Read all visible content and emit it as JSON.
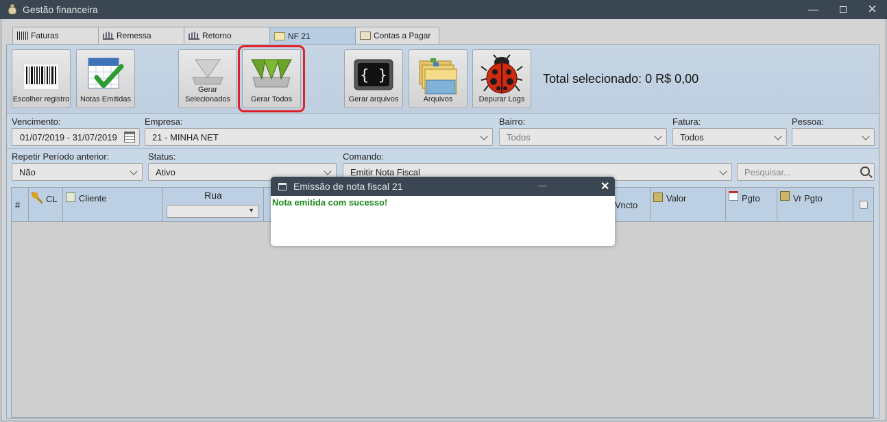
{
  "window": {
    "title": "Gestão financeira",
    "minimize_icon": "minimize-icon",
    "maximize_icon": "maximize-icon",
    "close_icon": "close-icon"
  },
  "tabs": [
    {
      "label": "Faturas",
      "icon": "barcode-icon",
      "active": false
    },
    {
      "label": "Remessa",
      "icon": "bank-icon",
      "active": false
    },
    {
      "label": "Retorno",
      "icon": "bank-icon",
      "active": false
    },
    {
      "label": "NF 21",
      "icon": "certificate-icon",
      "active": true
    },
    {
      "label": "Contas a Pagar",
      "icon": "bill-icon",
      "active": false
    }
  ],
  "toolbar": {
    "buttons": [
      {
        "label": "Escolher registro",
        "icon": "barcode-icon"
      },
      {
        "label": "Notas Emitidas",
        "icon": "calendar-check-icon"
      },
      {
        "label": "Gerar Selecionados",
        "icon": "generate-selected-icon"
      },
      {
        "label": "Gerar Todos",
        "icon": "generate-all-icon"
      },
      {
        "label": "Gerar arquivos",
        "icon": "code-terminal-icon"
      },
      {
        "label": "Arquivos",
        "icon": "folders-icon"
      },
      {
        "label": "Depurar Logs",
        "icon": "ladybug-icon"
      }
    ],
    "total_text": "Total selecionado: 0 R$ 0,00"
  },
  "filters": {
    "vencimento": {
      "label": "Vencimento:",
      "value": "01/07/2019 - 31/07/2019"
    },
    "empresa": {
      "label": "Empresa:",
      "value": "21 - MINHA NET"
    },
    "bairro": {
      "label": "Bairro:",
      "value": "Todos"
    },
    "fatura": {
      "label": "Fatura:",
      "value": "Todos"
    },
    "pessoa": {
      "label": "Pessoa:",
      "value": ""
    },
    "repetir": {
      "label": "Repetir Período anterior:",
      "value": "Não"
    },
    "status": {
      "label": "Status:",
      "value": "Ativo"
    },
    "comando": {
      "label": "Comando:",
      "value": "Emitir Nota Fiscal"
    },
    "search": {
      "placeholder": "Pesquisar..."
    }
  },
  "grid": {
    "columns": [
      {
        "label": "#"
      },
      {
        "label": "CL",
        "icon": "key-icon"
      },
      {
        "label": "Cliente",
        "icon": "contact-card-icon"
      },
      {
        "label": "Rua"
      },
      {
        "label": "Vncto"
      },
      {
        "label": "Valor",
        "icon": "money-icon"
      },
      {
        "label": "Pgto",
        "icon": "calendar-icon"
      },
      {
        "label": "Vr Pgto",
        "icon": "money-icon"
      }
    ]
  },
  "dialog": {
    "title": "Emissão de nota fiscal 21",
    "message": "Nota emitida com sucesso!",
    "minimize_label": "—",
    "close_label": "✕"
  },
  "colors": {
    "titlebar": "#3a4651",
    "active_tab": "#b8cde2",
    "highlight": "#e02028",
    "success_text": "#1a8a1a"
  }
}
